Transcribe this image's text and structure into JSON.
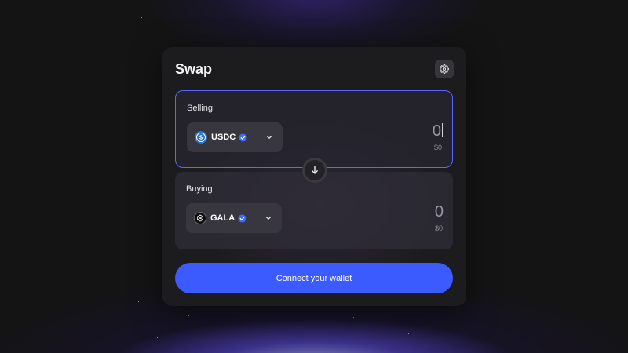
{
  "swap": {
    "title": "Swap",
    "settings_icon": "gear-icon",
    "selling": {
      "label": "Selling",
      "token": {
        "symbol": "USDC",
        "icon": "usdc-icon",
        "verified_icon": "verified-badge-icon"
      },
      "amount": "0",
      "usd_value": "$0"
    },
    "buying": {
      "label": "Buying",
      "token": {
        "symbol": "GALA",
        "icon": "gala-icon",
        "verified_icon": "verified-badge-icon"
      },
      "amount": "0",
      "usd_value": "$0"
    },
    "switch_icon": "arrow-down-icon",
    "connect_label": "Connect your wallet"
  },
  "colors": {
    "accent": "#3c5bff",
    "selected_border": "#5a66ff",
    "verified": "#3b6cff",
    "usdc": "#2775ca",
    "background": "#141414",
    "card": "#1c1c1f"
  }
}
